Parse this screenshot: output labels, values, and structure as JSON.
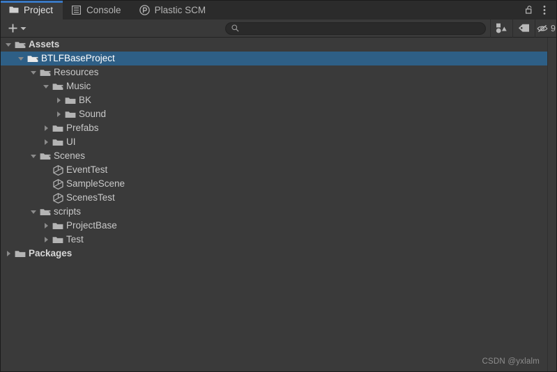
{
  "window": {
    "title": "Project",
    "accent_color": "#3a79c4",
    "selection_color": "#2e5f86",
    "background_color": "#3a3a3a"
  },
  "tabs": [
    {
      "label": "Project",
      "icon": "folder-icon",
      "active": true
    },
    {
      "label": "Console",
      "icon": "console-list-icon",
      "active": false
    },
    {
      "label": "Plastic SCM",
      "icon": "plastic-scm-icon",
      "active": false
    }
  ],
  "tabbar_actions": [
    {
      "name": "lock-icon",
      "label": "Lock"
    },
    {
      "name": "kebab-menu-icon",
      "label": "More"
    }
  ],
  "toolbar": {
    "add_label": "+",
    "add_dropdown_icon": "chevron-down-icon",
    "search": {
      "value": "",
      "placeholder": "",
      "icon": "search-icon"
    },
    "buttons": [
      {
        "name": "type-filter-icon",
        "label": "",
        "count": ""
      },
      {
        "name": "label-filter-icon",
        "label": "",
        "count": ""
      },
      {
        "name": "hidden-packages-icon",
        "label": "",
        "count": "9"
      }
    ]
  },
  "tree": {
    "rows": [
      {
        "label": "Assets",
        "depth": 0,
        "arrow": "down",
        "icon": "folder-open-icon",
        "bold": true,
        "selected": false
      },
      {
        "label": "BTLFBaseProject",
        "depth": 1,
        "arrow": "down",
        "icon": "folder-open-icon",
        "bold": false,
        "selected": true
      },
      {
        "label": "Resources",
        "depth": 2,
        "arrow": "down",
        "icon": "folder-open-icon",
        "bold": false,
        "selected": false
      },
      {
        "label": "Music",
        "depth": 3,
        "arrow": "down",
        "icon": "folder-open-icon",
        "bold": false,
        "selected": false
      },
      {
        "label": "BK",
        "depth": 4,
        "arrow": "right",
        "icon": "folder-closed-icon",
        "bold": false,
        "selected": false
      },
      {
        "label": "Sound",
        "depth": 4,
        "arrow": "right",
        "icon": "folder-closed-icon",
        "bold": false,
        "selected": false
      },
      {
        "label": "Prefabs",
        "depth": 3,
        "arrow": "right",
        "icon": "folder-closed-icon",
        "bold": false,
        "selected": false
      },
      {
        "label": "UI",
        "depth": 3,
        "arrow": "right",
        "icon": "folder-closed-icon",
        "bold": false,
        "selected": false
      },
      {
        "label": "Scenes",
        "depth": 2,
        "arrow": "down",
        "icon": "folder-open-icon",
        "bold": false,
        "selected": false
      },
      {
        "label": "EventTest",
        "depth": 3,
        "arrow": "none",
        "icon": "unity-scene-icon",
        "bold": false,
        "selected": false
      },
      {
        "label": "SampleScene",
        "depth": 3,
        "arrow": "none",
        "icon": "unity-scene-icon",
        "bold": false,
        "selected": false
      },
      {
        "label": "ScenesTest",
        "depth": 3,
        "arrow": "none",
        "icon": "unity-scene-icon",
        "bold": false,
        "selected": false
      },
      {
        "label": "scripts",
        "depth": 2,
        "arrow": "down",
        "icon": "folder-open-icon",
        "bold": false,
        "selected": false
      },
      {
        "label": "ProjectBase",
        "depth": 3,
        "arrow": "right",
        "icon": "folder-closed-icon",
        "bold": false,
        "selected": false
      },
      {
        "label": "Test",
        "depth": 3,
        "arrow": "right",
        "icon": "folder-closed-icon",
        "bold": false,
        "selected": false
      },
      {
        "label": "Packages",
        "depth": 0,
        "arrow": "right",
        "icon": "folder-closed-icon",
        "bold": true,
        "selected": false
      }
    ]
  },
  "watermark": "CSDN @yxlalm"
}
